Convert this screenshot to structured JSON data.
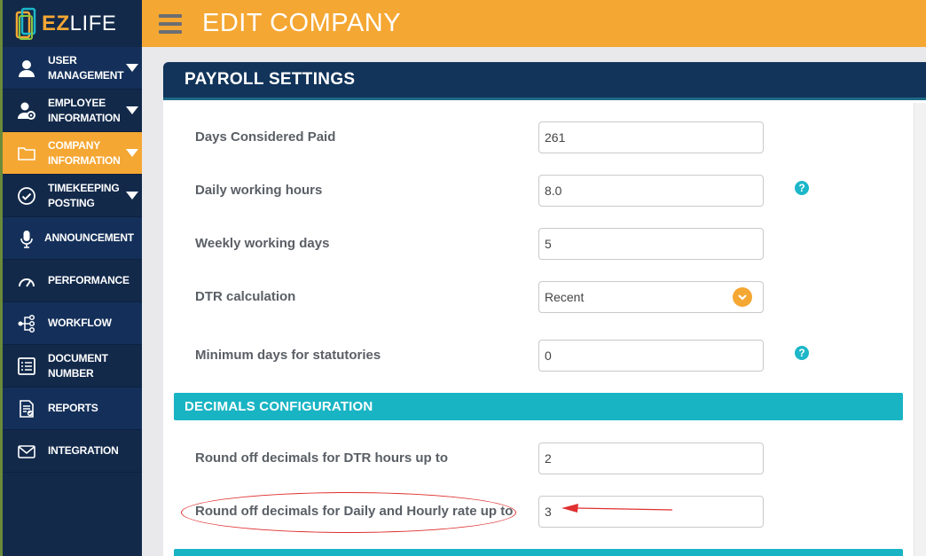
{
  "app": {
    "logo_prefix": "EZ",
    "logo_suffix": "LIFE"
  },
  "header": {
    "title": "EDIT COMPANY"
  },
  "sidebar": {
    "items": [
      {
        "label": "USER MANAGEMENT",
        "icon": "user-icon",
        "expandable": true
      },
      {
        "label": "EMPLOYEE INFORMATION",
        "icon": "user-gear-icon",
        "expandable": true
      },
      {
        "label": "COMPANY INFORMATION",
        "icon": "folder-icon",
        "expandable": true,
        "active": true
      },
      {
        "label": "TIMEKEEPING POSTING",
        "icon": "check-circle-icon",
        "expandable": true
      },
      {
        "label": "ANNOUNCEMENT",
        "icon": "microphone-icon",
        "expandable": false
      },
      {
        "label": "PERFORMANCE",
        "icon": "gauge-icon",
        "expandable": false
      },
      {
        "label": "WORKFLOW",
        "icon": "workflow-icon",
        "expandable": false
      },
      {
        "label": "DOCUMENT NUMBER",
        "icon": "list-icon",
        "expandable": false
      },
      {
        "label": "REPORTS",
        "icon": "report-icon",
        "expandable": false
      },
      {
        "label": "INTEGRATION",
        "icon": "envelope-icon",
        "expandable": false
      }
    ]
  },
  "payroll": {
    "title": "PAYROLL SETTINGS",
    "fields": [
      {
        "label": "Days Considered Paid",
        "value": "261"
      },
      {
        "label": "Daily working hours",
        "value": "8.0",
        "help": "?"
      },
      {
        "label": "Weekly working days",
        "value": "5"
      },
      {
        "label": "DTR calculation",
        "value": "Recent"
      },
      {
        "label": "Minimum days for statutories",
        "value": "0",
        "help": "?"
      }
    ]
  },
  "decimals": {
    "title": "DECIMALS CONFIGURATION",
    "fields": [
      {
        "label": "Round off decimals for DTR hours up to",
        "value": "2"
      },
      {
        "label": "Round off decimals for Daily and Hourly rate up to",
        "value": "3"
      }
    ]
  },
  "colors": {
    "sidebar": "#12294a",
    "accent": "#f5a733",
    "section": "#12345a",
    "subsection": "#19b4c4",
    "annotation": "#e03030"
  }
}
